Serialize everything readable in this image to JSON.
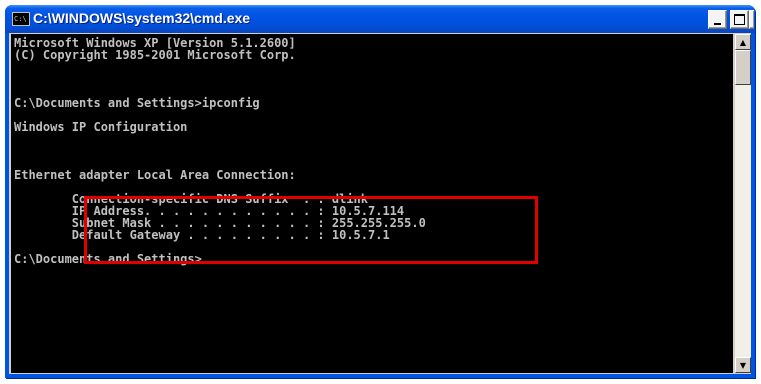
{
  "window": {
    "title": "C:\\WINDOWS\\system32\\cmd.exe",
    "icon_label": "C:\\",
    "controls": {
      "minimize": "minimize-icon",
      "maximize": "maximize-icon",
      "close_glyph": "×"
    }
  },
  "console": {
    "lines": [
      "Microsoft Windows XP [Version 5.1.2600]",
      "(C) Copyright 1985-2001 Microsoft Corp.",
      "",
      "",
      "",
      "C:\\Documents and Settings>ipconfig",
      "",
      "Windows IP Configuration",
      "",
      "",
      "",
      "Ethernet adapter Local Area Connection:",
      "",
      "        Connection-specific DNS Suffix  . : dlink",
      "        IP Address. . . . . . . . . . . . : 10.5.7.114",
      "        Subnet Mask . . . . . . . . . . . : 255.255.255.0",
      "        Default Gateway . . . . . . . . . : 10.5.7.1",
      "",
      "C:\\Documents and Settings>"
    ],
    "highlight_color": "#e00000"
  },
  "scrollbar": {
    "up_glyph": "▲",
    "down_glyph": "▼"
  }
}
